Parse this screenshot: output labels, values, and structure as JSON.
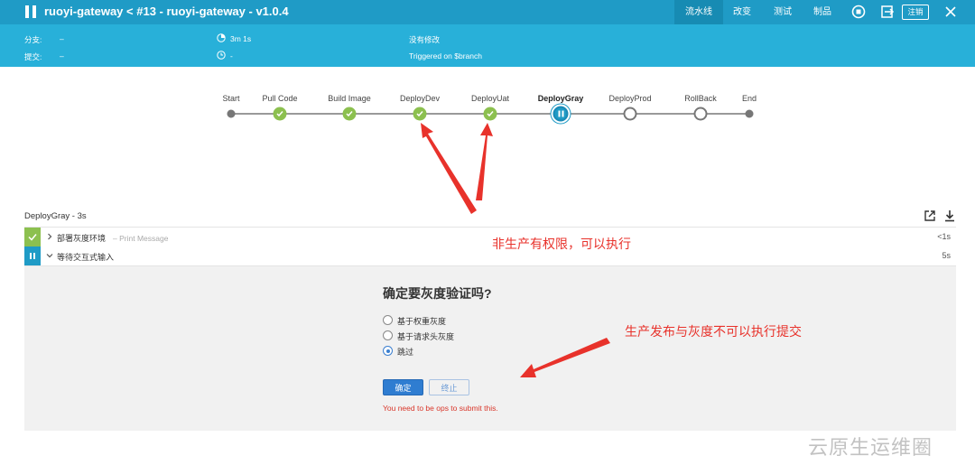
{
  "header": {
    "title": "ruoyi-gateway < #13 - ruoyi-gateway - v1.0.4",
    "tabs": [
      {
        "label": "流水线",
        "active": true
      },
      {
        "label": "改变",
        "active": false
      },
      {
        "label": "测试",
        "active": false
      },
      {
        "label": "制品",
        "active": false
      }
    ],
    "logout_label": "注销"
  },
  "info": {
    "branch_label": "分支:",
    "branch_value": "–",
    "commit_label": "提交:",
    "commit_value": "–",
    "duration": "3m 1s",
    "time": "-",
    "changes": "没有修改",
    "trigger": "Triggered on $branch"
  },
  "pipeline": {
    "stages": [
      {
        "name": "Start",
        "status": "end"
      },
      {
        "name": "Pull Code",
        "status": "success"
      },
      {
        "name": "Build Image",
        "status": "success"
      },
      {
        "name": "DeployDev",
        "status": "success"
      },
      {
        "name": "DeployUat",
        "status": "success"
      },
      {
        "name": "DeployGray",
        "status": "paused"
      },
      {
        "name": "DeployProd",
        "status": "pending"
      },
      {
        "name": "RollBack",
        "status": "pending"
      },
      {
        "name": "End",
        "status": "end"
      }
    ]
  },
  "stage_detail": {
    "title": "DeployGray - 3s",
    "steps": [
      {
        "name": "部署灰度环境",
        "sub": "– Print Message",
        "duration": "<1s",
        "status": "success"
      },
      {
        "name": "等待交互式输入",
        "sub": "",
        "duration": "5s",
        "status": "paused"
      }
    ]
  },
  "input_form": {
    "question": "确定要灰度验证吗?",
    "options": [
      {
        "label": "基于权重灰度",
        "selected": false
      },
      {
        "label": "基于请求头灰度",
        "selected": false
      },
      {
        "label": "跳过",
        "selected": true
      }
    ],
    "ok_label": "确定",
    "abort_label": "终止",
    "error": "You need to be ops to submit this."
  },
  "annotations": {
    "note1": "非生产有权限，可以执行",
    "note2": "生产发布与灰度不可以执行提交",
    "color": "#e8322b"
  },
  "watermark": "云原生运维圈",
  "colors": {
    "header": "#1f9bc6",
    "infobar": "#28b0d9",
    "success": "#8cc04f",
    "primary": "#2f7dd1",
    "error": "#d9362a"
  }
}
